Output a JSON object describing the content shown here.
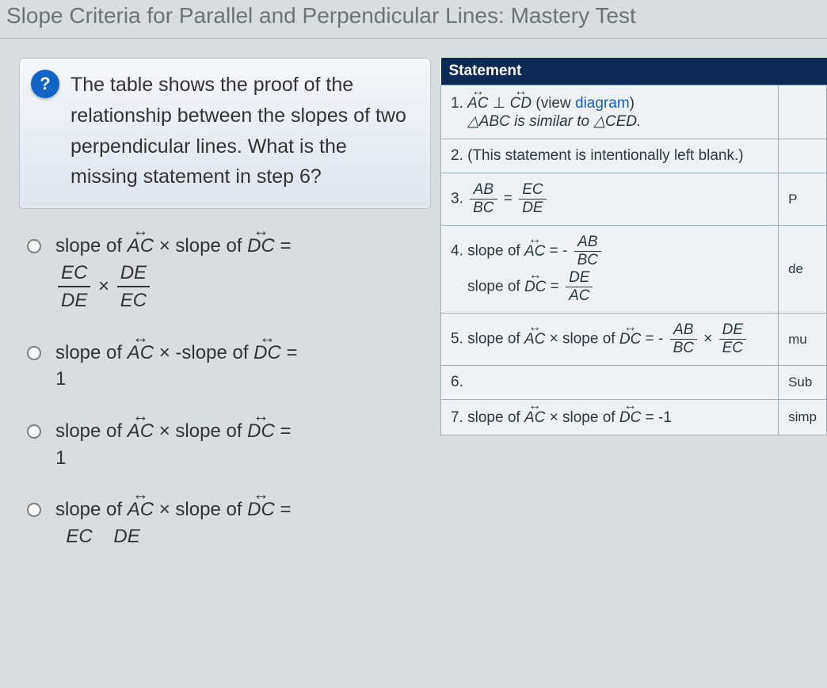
{
  "page_title": "Slope Criteria for Parallel and Perpendicular Lines: Mastery Test",
  "question_icon": "?",
  "question_text": "The table shows the proof of the relationship between the slopes of two perpendicular lines. What is the missing statement in step 6?",
  "answers": {
    "a": {
      "prefix": "slope of ",
      "seg1": "AC",
      "mid": " × slope of ",
      "seg2": "DC",
      "eq": " =",
      "f1n": "EC",
      "f1d": "DE",
      "times": " × ",
      "f2n": "DE",
      "f2d": "EC"
    },
    "b": {
      "prefix": "slope of ",
      "seg1": "AC",
      "mid": " × -slope of ",
      "seg2": "DC",
      "eq": " =",
      "line2": "1"
    },
    "c": {
      "prefix": "slope of ",
      "seg1": "AC",
      "mid": " × slope of ",
      "seg2": "DC",
      "eq": " =",
      "line2": "1"
    },
    "d": {
      "prefix": "slope of ",
      "seg1": "AC",
      "mid": " × slope of ",
      "seg2": "DC",
      "eq": " =",
      "l2a": "EC",
      "l2b": "DE"
    }
  },
  "table": {
    "header": "Statement",
    "rows": {
      "r1": {
        "num": "1. ",
        "seg1": "AC",
        "perp": " ⊥ ",
        "seg2": "CD",
        "viewl": " (view ",
        "diagram": "diagram",
        "viewr": ")",
        "sim": "△ABC is similar to △CED."
      },
      "r2": {
        "num": "2. ",
        "txt": "(This statement is intentionally left blank.)"
      },
      "r3": {
        "num": "3. ",
        "f1n": "AB",
        "f1d": "BC",
        "eq": " = ",
        "f2n": "EC",
        "f2d": "DE",
        "reason": "P"
      },
      "r4": {
        "num": "4. ",
        "pre": "slope of ",
        "seg1": "AC",
        "eq1": " = ",
        "neg": "- ",
        "f1n": "AB",
        "f1d": "BC",
        "pre2": "slope of ",
        "seg2": "DC",
        "eq2": " = ",
        "f2n": "DE",
        "f2d": "AC",
        "reason": "de"
      },
      "r5": {
        "num": "5. ",
        "pre": "slope of ",
        "seg1": "AC",
        "mid": " × slope of ",
        "seg2": "DC",
        "eq": " = ",
        "neg": "- ",
        "f1n": "AB",
        "f1d": "BC",
        "times": " × ",
        "f2n": "DE",
        "f2d": "EC",
        "reason": "mu"
      },
      "r6": {
        "num": "6.",
        "reason": "Sub"
      },
      "r7": {
        "num": "7. ",
        "pre": "slope of ",
        "seg1": "AC",
        "mid": " × slope of ",
        "seg2": "DC",
        "eq": " = -1",
        "reason": "simp"
      }
    }
  }
}
